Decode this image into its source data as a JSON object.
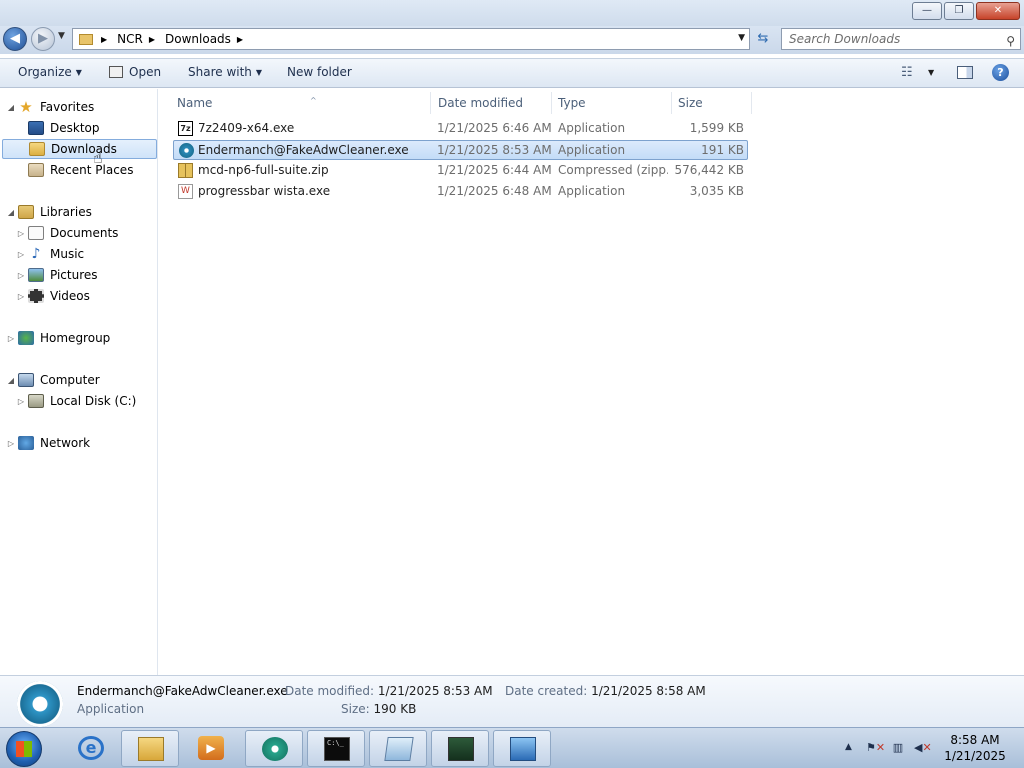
{
  "window": {
    "caption": {
      "minimize": "—",
      "maximize": "❐",
      "close": "✕"
    }
  },
  "address": {
    "crumbs": [
      "NCR",
      "Downloads"
    ],
    "search_placeholder": "Search Downloads"
  },
  "toolbar": {
    "organize": "Organize",
    "open": "Open",
    "share_with": "Share with",
    "new_folder": "New folder"
  },
  "nav": {
    "favorites": "Favorites",
    "desktop": "Desktop",
    "downloads": "Downloads",
    "recent_places": "Recent Places",
    "libraries": "Libraries",
    "documents": "Documents",
    "music": "Music",
    "pictures": "Pictures",
    "videos": "Videos",
    "homegroup": "Homegroup",
    "computer": "Computer",
    "local_disk": "Local Disk (C:)",
    "network": "Network"
  },
  "columns": {
    "name": "Name",
    "date_modified": "Date modified",
    "type": "Type",
    "size": "Size"
  },
  "files": [
    {
      "name": "7z2409-x64.exe",
      "date": "1/21/2025 6:46 AM",
      "type": "Application",
      "size": "1,599 KB",
      "icon": "7zip-icon"
    },
    {
      "name": "Endermanch@FakeAdwCleaner.exe",
      "date": "1/21/2025 8:53 AM",
      "type": "Application",
      "size": "191 KB",
      "icon": "adwcleaner-icon"
    },
    {
      "name": "mcd-np6-full-suite.zip",
      "date": "1/21/2025 6:44 AM",
      "type": "Compressed (zipp...",
      "size": "576,442 KB",
      "icon": "zip-folder-icon"
    },
    {
      "name": "progressbar wista.exe",
      "date": "1/21/2025 6:48 AM",
      "type": "Application",
      "size": "3,035 KB",
      "icon": "exe-icon"
    }
  ],
  "selected_file_index": 1,
  "details": {
    "name": "Endermanch@FakeAdwCleaner.exe",
    "type": "Application",
    "date_modified_label": "Date modified:",
    "date_modified": "1/21/2025 8:53 AM",
    "date_created_label": "Date created:",
    "date_created": "1/21/2025 8:58 AM",
    "size_label": "Size:",
    "size": "190 KB"
  },
  "taskbar": {
    "time": "8:58 AM",
    "date": "1/21/2025",
    "cmd_glyph": "C:\\_"
  },
  "colors": {
    "selection_fill": "#cfe3f9",
    "selection_border": "#84acdd",
    "taskbar": "#b9cce3"
  }
}
